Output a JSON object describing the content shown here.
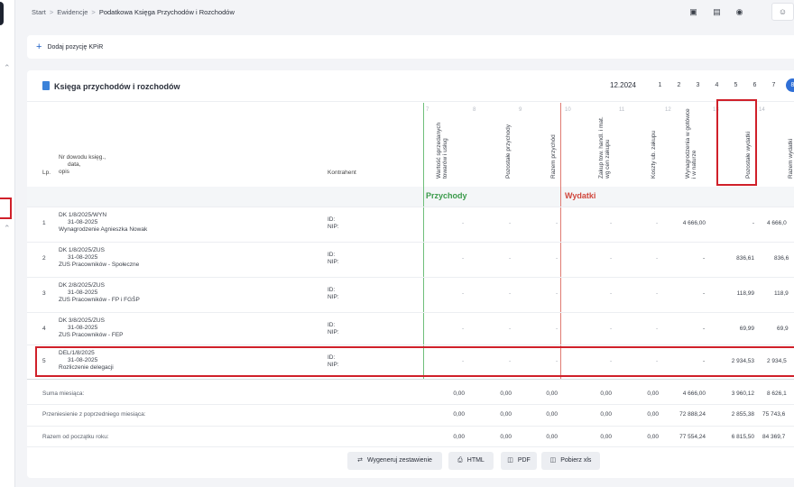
{
  "breadcrumb": [
    "Start",
    "Ewidencje",
    "Podatkowa Księga Przychodów i Rozchodów"
  ],
  "toolbar": {
    "add_label": "Dodaj pozycję KPiR"
  },
  "card": {
    "title": "Księga przychodów i rozchodów",
    "month": "12.2024",
    "pages": [
      "1",
      "2",
      "3",
      "4",
      "5",
      "6",
      "7",
      "8"
    ],
    "active_page": "8"
  },
  "columns": {
    "lp": "Lp.",
    "nr_line1": "Nr dowodu księg.,",
    "nr_line2": "data,",
    "nr_line3": "opis",
    "kontrahent": "Kontrahent",
    "c7": "Wartość sprzedanych towarów i usług",
    "c8": "Pozostałe przychody",
    "c9": "Razem przychód",
    "c10": "Zakup tow. handl. i mat. wg cen zakupu",
    "c11": "Koszty ub. zakupu",
    "c12": "Wynagrodzenia w gotówce i w naturze",
    "c13": "Pozostałe wydatki",
    "c14": "Razem wydatki",
    "nums": [
      "7",
      "8",
      "9",
      "10",
      "11",
      "12",
      "13",
      "14"
    ]
  },
  "sections": {
    "przychody": "Przychody",
    "wydatki": "Wydatki"
  },
  "contractor": {
    "id_label": "ID:",
    "nip_label": "NIP:"
  },
  "dash": "-",
  "rows": [
    {
      "lp": "1",
      "nr": "DK 1/8/2025/WYN",
      "date": "31-08-2025",
      "desc": "Wynagrodzenie Agnieszka Nowak",
      "wyn": "4 666,00",
      "pozostale": "-",
      "razem": "4 666,0"
    },
    {
      "lp": "2",
      "nr": "DK 1/8/2025/ZUS",
      "date": "31-08-2025",
      "desc": "ZUS Pracowników - Społeczne",
      "wyn": "-",
      "pozostale": "836,61",
      "razem": "836,6"
    },
    {
      "lp": "3",
      "nr": "DK 2/8/2025/ZUS",
      "date": "31-08-2025",
      "desc": "ZUS Pracowników - FP i FGŚP",
      "wyn": "-",
      "pozostale": "118,99",
      "razem": "118,9"
    },
    {
      "lp": "4",
      "nr": "DK 3/8/2025/ZUS",
      "date": "31-08-2025",
      "desc": "ZUS Pracowników - FEP",
      "wyn": "-",
      "pozostale": "69,99",
      "razem": "69,9"
    },
    {
      "lp": "5",
      "nr": "DEL/1/8/2025",
      "date": "31-08-2025",
      "desc": "Rozliczenie delegacji",
      "wyn": "-",
      "pozostale": "2 934,53",
      "razem": "2 934,5"
    }
  ],
  "summary": [
    {
      "label": "Suma miesiąca:",
      "v": [
        "0,00",
        "0,00",
        "0,00",
        "0,00",
        "0,00",
        "4 666,00",
        "3 960,12",
        "8 626,1"
      ]
    },
    {
      "label": "Przeniesienie z poprzedniego miesiąca:",
      "v": [
        "0,00",
        "0,00",
        "0,00",
        "0,00",
        "0,00",
        "72 888,24",
        "2 855,38",
        "75 743,6"
      ]
    },
    {
      "label": "Razem od początku roku:",
      "v": [
        "0,00",
        "0,00",
        "0,00",
        "0,00",
        "0,00",
        "77 554,24",
        "6 815,50",
        "84 369,7"
      ]
    }
  ],
  "actions": {
    "generate": "Wygeneruj zestawienie",
    "html": "HTML",
    "pdf": "PDF",
    "xls": "Pobierz xls"
  },
  "colors": {
    "accent": "#2f6fd6",
    "income": "#3a9a4a",
    "expense": "#d0463c",
    "highlight": "#d0202a"
  }
}
